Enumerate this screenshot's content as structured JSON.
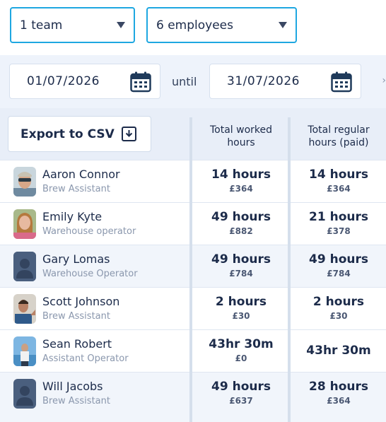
{
  "filters": {
    "team": "1 team",
    "employees": "6 employees"
  },
  "date_range": {
    "from": "01/07/2026",
    "until_label": "until",
    "to": "31/07/2026"
  },
  "table": {
    "export_label": "Export to CSV",
    "col_worked": "Total worked\nhours",
    "col_regular": "Total regular\nhours (paid)",
    "rows": [
      {
        "name": "Aaron Connor",
        "role": "Brew Assistant",
        "worked_hours": "14 hours",
        "worked_pay": "£364",
        "regular_hours": "14 hours",
        "regular_pay": "£364"
      },
      {
        "name": "Emily Kyte",
        "role": "Warehouse operator",
        "worked_hours": "49 hours",
        "worked_pay": "£882",
        "regular_hours": "21 hours",
        "regular_pay": "£378"
      },
      {
        "name": "Gary Lomas",
        "role": "Warehouse Operator",
        "worked_hours": "49 hours",
        "worked_pay": "£784",
        "regular_hours": "49 hours",
        "regular_pay": "£784"
      },
      {
        "name": "Scott Johnson",
        "role": "Brew Assistant",
        "worked_hours": "2 hours",
        "worked_pay": "£30",
        "regular_hours": "2 hours",
        "regular_pay": "£30"
      },
      {
        "name": "Sean Robert",
        "role": "Assistant Operator",
        "worked_hours": "43hr 30m",
        "worked_pay": "£0",
        "regular_hours": "43hr 30m",
        "regular_pay": ""
      },
      {
        "name": "Will Jacobs",
        "role": "Brew Assistant",
        "worked_hours": "49 hours",
        "worked_pay": "£637",
        "regular_hours": "28 hours",
        "regular_pay": "£364"
      }
    ]
  },
  "colors": {
    "accent": "#1ea7e1",
    "text": "#1c2b4a",
    "muted": "#8a97ad",
    "placeholder_avatar": "#4a5f7e"
  },
  "icons": {
    "dropdown": "chevron-down-icon",
    "calendar": "calendar-icon",
    "export": "download-icon",
    "avatar_placeholder": "user-silhouette-icon"
  }
}
